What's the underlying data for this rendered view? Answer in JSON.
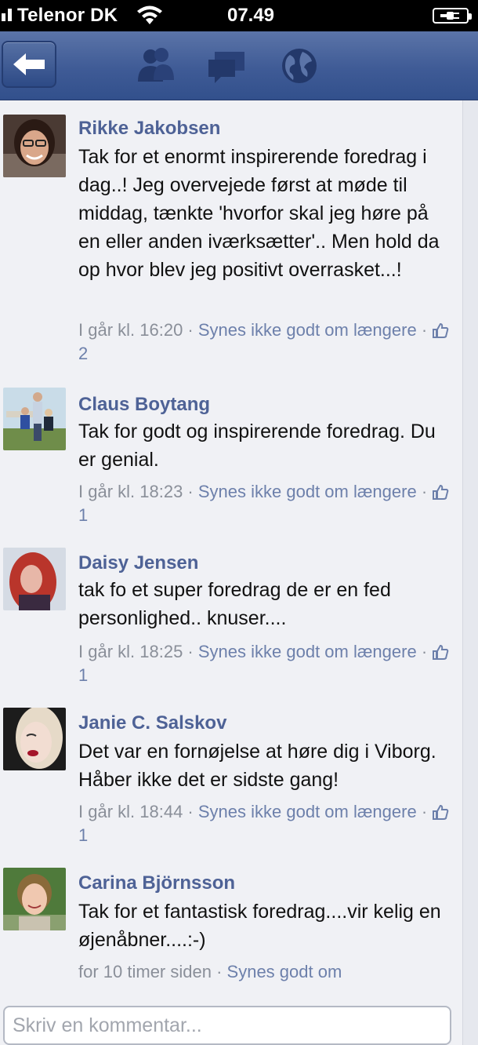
{
  "status_bar": {
    "carrier": "Telenor DK",
    "time": "07.49"
  },
  "nav": {
    "icons": [
      "back-arrow-icon",
      "friends-icon",
      "messages-icon",
      "globe-icon"
    ],
    "bar_color": "#3f5b96"
  },
  "comments": [
    {
      "name": "Rikke Jakobsen",
      "text": "Tak for et enormt inspirerende foredrag i dag..! Jeg overvejede først at møde til middag, tænkte 'hvorfor skal jeg høre på en eller anden iværksætter'.. Men hold da op hvor blev jeg positivt overrasket...!",
      "time": "I går kl. 16:20",
      "like_action": "Synes ikke godt om længere",
      "likes": "2"
    },
    {
      "name": "Claus Boytang",
      "text": "Tak for godt og inspirerende foredrag. Du er genial.",
      "time": "I går kl. 18:23",
      "like_action": "Synes ikke godt om længere",
      "likes": "1"
    },
    {
      "name": "Daisy Jensen",
      "text": "tak fo et super foredrag de er en fed personlighed.. knuser....",
      "time": "I går kl. 18:25",
      "like_action": "Synes ikke godt om længere",
      "likes": "1"
    },
    {
      "name": "Janie C. Salskov",
      "text": "Det var en fornøjelse at høre dig i Viborg. Håber ikke det er sidste gang!",
      "time": "I går kl. 18:44",
      "like_action": "Synes ikke godt om længere",
      "likes": "1"
    },
    {
      "name": "Carina Björnsson",
      "text": "Tak for et fantastisk foredrag....vir kelig en øjenåbner....:-)",
      "time": "for 10 timer siden",
      "like_action": "Synes godt om"
    }
  ],
  "compose": {
    "placeholder": "Skriv en kommentar..."
  },
  "colors": {
    "name": "#4e6296",
    "meta": "#8a8f99",
    "background": "#f0f1f5"
  }
}
